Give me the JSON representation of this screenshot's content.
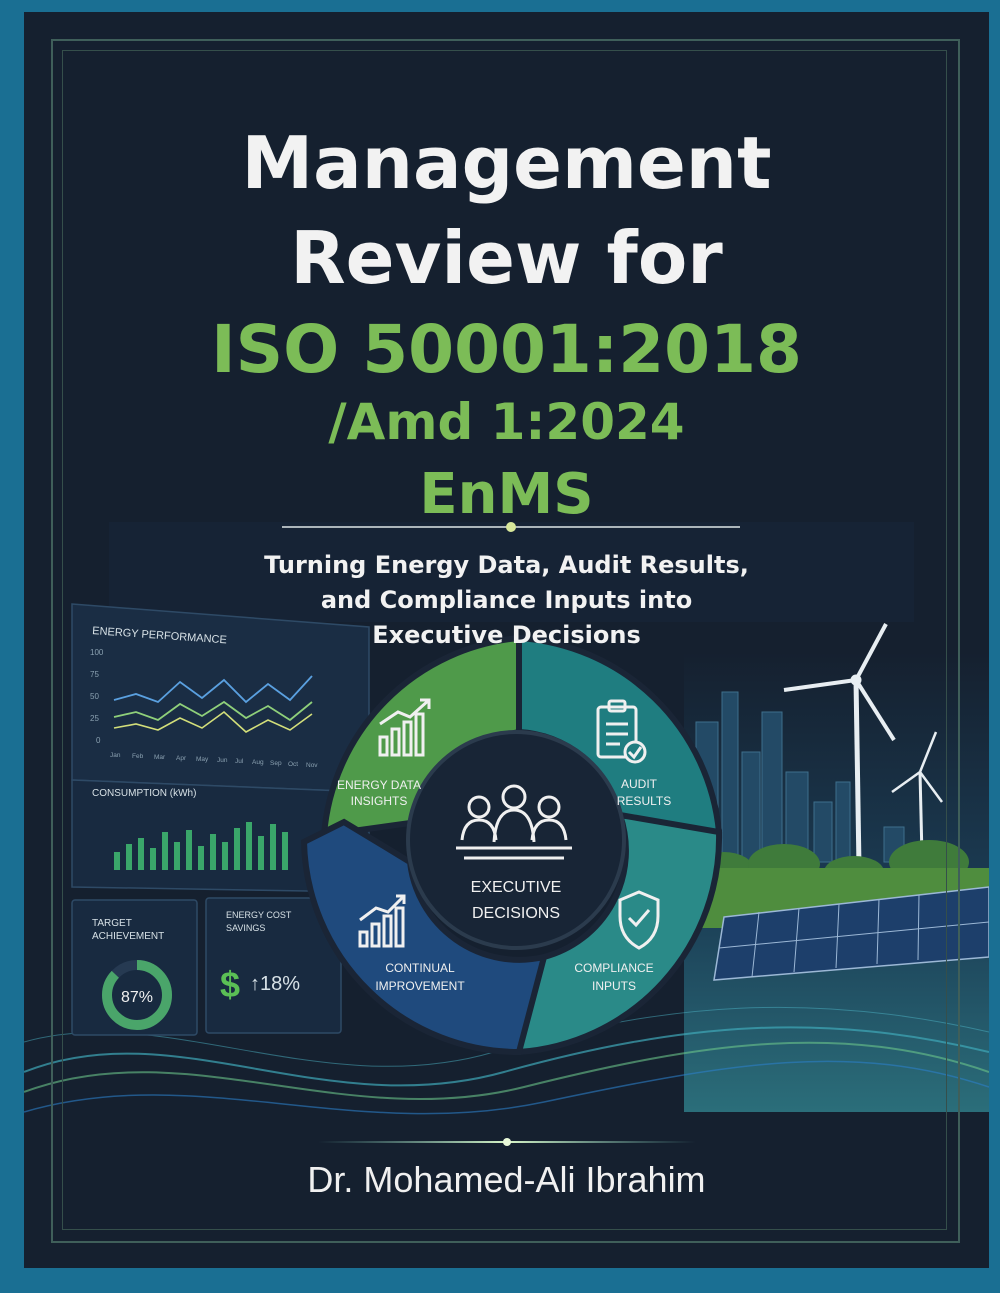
{
  "cover": {
    "title_line1": "Management",
    "title_line2": "Review for",
    "title_line3": "ISO 50001:2018",
    "title_line4": "/Amd 1:2024",
    "title_line5": "EnMS",
    "subtitle_line1": "Turning Energy Data, Audit Results,",
    "subtitle_line2": "and Compliance Inputs into",
    "subtitle_line3": "Executive Decisions",
    "author": "Dr. Mohamed-Ali Ibrahim"
  },
  "dashboard": {
    "energy_performance": "ENERGY PERFORMANCE",
    "y_ticks": [
      "100",
      "75",
      "50",
      "25",
      "0"
    ],
    "months": [
      "Jan",
      "Feb",
      "Mar",
      "Apr",
      "May",
      "Jun",
      "Jul",
      "Aug",
      "Sep",
      "Oct",
      "Nov"
    ],
    "consumption": "CONSUMPTION (kWh)",
    "target_line1": "TARGET",
    "target_line2": "ACHIEVEMENT",
    "target_value": "87%",
    "target_fraction": 0.87,
    "savings_line1": "ENERGY COST",
    "savings_line2": "SAVINGS",
    "savings_symbol": "$",
    "savings_value": "↑18%"
  },
  "cycle": {
    "seg_energy_line1": "ENERGY DATA",
    "seg_energy_line2": "INSIGHTS",
    "seg_audit_line1": "AUDIT",
    "seg_audit_line2": "RESULTS",
    "seg_compliance_line1": "COMPLIANCE",
    "seg_compliance_line2": "INPUTS",
    "seg_improvement_line1": "CONTINUAL",
    "seg_improvement_line2": "IMPROVEMENT",
    "center_line1": "EXECUTIVE",
    "center_line2": "DECISIONS"
  },
  "colors": {
    "background": "#15202f",
    "outer_border": "#1a6f93",
    "accent_green": "#7cbc57",
    "segment_green": "#4f9a4a",
    "segment_teal": "#1f7d80",
    "segment_blue": "#1f4a7d"
  }
}
